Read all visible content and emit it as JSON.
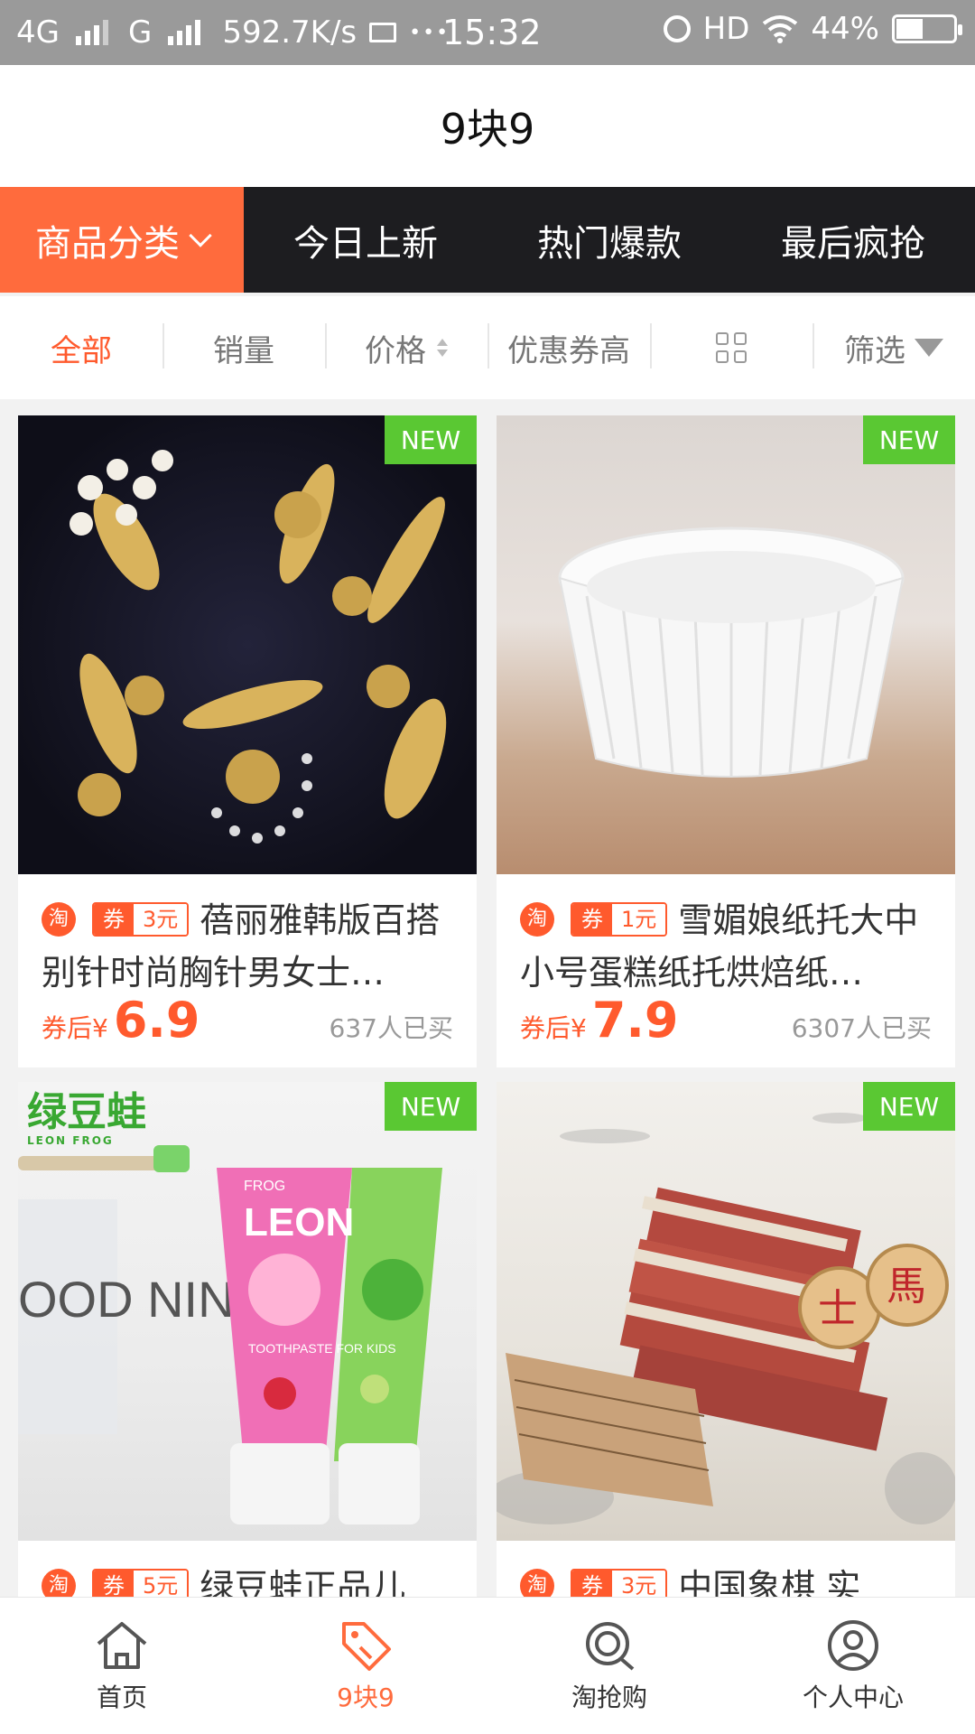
{
  "status_bar": {
    "network1": "4G",
    "network2": "G",
    "speed": "592.7K/s",
    "dots": "•••",
    "time": "15:32",
    "hd": "HD",
    "battery": "44%",
    "battery_level": 0.44
  },
  "header": {
    "title": "9块9"
  },
  "category_tabs": [
    {
      "label": "商品分类",
      "active": true
    },
    {
      "label": "今日上新",
      "active": false
    },
    {
      "label": "热门爆款",
      "active": false
    },
    {
      "label": "最后疯抢",
      "active": false
    }
  ],
  "sort_bar": {
    "all": "全部",
    "sales": "销量",
    "price": "价格",
    "coupon_high": "优惠券高",
    "filter": "筛选"
  },
  "products": [
    {
      "badge": "NEW",
      "platform": "淘",
      "coupon_prefix": "券",
      "coupon_value": "3元",
      "title": "蓓丽雅韩版百搭别针时尚胸针男女士…",
      "price_label": "券后¥",
      "price": "6.9",
      "sold": "637人已买"
    },
    {
      "badge": "NEW",
      "platform": "淘",
      "coupon_prefix": "券",
      "coupon_value": "1元",
      "title": "雪媚娘纸托大中小号蛋糕纸托烘焙纸…",
      "price_label": "券后¥",
      "price": "7.9",
      "sold": "6307人已买"
    },
    {
      "badge": "NEW",
      "platform": "淘",
      "coupon_prefix": "券",
      "coupon_value": "5元",
      "title": "绿豆蛙正品儿",
      "image_text": {
        "brand": "绿豆蛙",
        "brand_en": "LEON FROG",
        "tube_brand": "LEON",
        "tube_frog": "FROG",
        "tube_label": "TOOTHPASTE FOR KIDS",
        "bg_text": "OOD NING"
      }
    },
    {
      "badge": "NEW",
      "platform": "淘",
      "coupon_prefix": "券",
      "coupon_value": "3元",
      "title": "中国象棋 实",
      "image_text": {
        "piece1": "士",
        "piece2": "馬"
      }
    }
  ],
  "bottom_nav": [
    {
      "label": "首页",
      "icon": "home-icon",
      "active": false
    },
    {
      "label": "9块9",
      "icon": "price-tag-icon",
      "active": true
    },
    {
      "label": "淘抢购",
      "icon": "search-grab-icon",
      "active": false
    },
    {
      "label": "个人中心",
      "icon": "user-icon",
      "active": false
    }
  ],
  "colors": {
    "accent": "#ff6b3d",
    "tab_bar": "#1d1d20",
    "new_badge": "#5ac833"
  }
}
